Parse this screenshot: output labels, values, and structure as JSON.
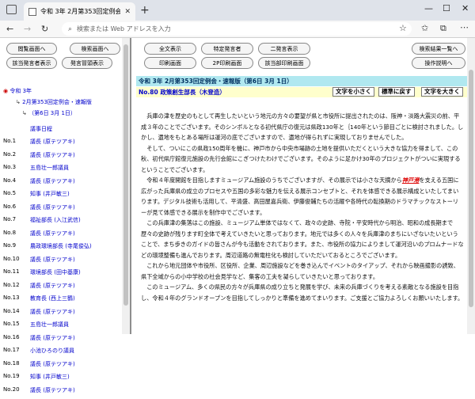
{
  "browser": {
    "tab_title": "令和 3年 2月第353回定例会・速報",
    "tab_close": "✕",
    "new_tab": "+",
    "address_placeholder": "検索または Web アドレスを入力"
  },
  "left": {
    "buttons": {
      "meeting_view": "閲覧画面へ",
      "search_view": "検索画面へ",
      "speaker_list": "該当発言者表示",
      "speaker_heading": "発言冒頭表示"
    },
    "tree": {
      "year": "令和 3年",
      "session": "2月第353回定例会・速報版",
      "day": "（第6日 3月 1日）",
      "agenda": "議事日程"
    },
    "speakers": [
      {
        "no": "No.1",
        "name": "議長 (原テツアキ)"
      },
      {
        "no": "No.2",
        "name": "議長 (原テツアキ)"
      },
      {
        "no": "No.3",
        "name": "五島壮一郎議員"
      },
      {
        "no": "No.4",
        "name": "議長 (原テツアキ)"
      },
      {
        "no": "No.5",
        "name": "知事 (井戸敏三)"
      },
      {
        "no": "No.6",
        "name": "議長 (原テツアキ)"
      },
      {
        "no": "No.7",
        "name": "福祉部長 (入江武信)"
      },
      {
        "no": "No.8",
        "name": "議長 (原テツアキ)"
      },
      {
        "no": "No.9",
        "name": "農政環境部長 (寺尾俊弘)"
      },
      {
        "no": "No.10",
        "name": "議長 (原テツアキ)"
      },
      {
        "no": "No.11",
        "name": "環境部長 (田中基康)"
      },
      {
        "no": "No.12",
        "name": "議長 (原テツアキ)"
      },
      {
        "no": "No.13",
        "name": "教育長 (西上三鶴)"
      },
      {
        "no": "No.14",
        "name": "議長 (原テツアキ)"
      },
      {
        "no": "No.15",
        "name": "五島壮一郎議員"
      },
      {
        "no": "No.16",
        "name": "議長 (原テツアキ)"
      },
      {
        "no": "No.17",
        "name": "小池ひろのり議員"
      },
      {
        "no": "No.18",
        "name": "議長 (原テツアキ)"
      },
      {
        "no": "No.19",
        "name": "知事 (井戸敏三)"
      },
      {
        "no": "No.20",
        "name": "議長 (原テツアキ)"
      }
    ]
  },
  "right": {
    "buttons": {
      "full_text": "全文表示",
      "specific_speaker": "特定発言者",
      "two_speakers": "二発言表示",
      "search_results": "検索結果一覧へ",
      "print_view": "印刷画面",
      "print_2p": "2P印刷画面",
      "print_selected": "該当部印刷画面",
      "operation_help": "操作説明へ"
    },
    "header_title": "令和 3年 2月第353回定例会・速報版（第6日 3月 1日）",
    "speech_no": "No.80",
    "speech_speaker": "政策創生部長（木登造）",
    "size_small": "文字を小さく",
    "size_reset": "標準に戻す",
    "size_large": "文字を大きく",
    "paragraphs": [
      "兵庫の津を歴史のもとして再生したいという地元の方々の要望が県と市役所に提出されたのは、阪神・淡路大震災の前、平成３年のことでございます。そのシンボルとなる初代県庁の復元は県政130年と｛140年という節目ごとに検討されました。しかし、遺地をもとある場所は運河の底でございますので、遺地が得られずに実現しておりませんでした。",
      "そして、ついにこの県政150周年を機に、神戸市から中央市場跡の土地を提供いただくという大きな協力を得まして、この秋、初代県庁館復元施設の先行会館にこぎつけたわけでございます。そのように足かけ30年のプロジェクトがついに実現するということでございます。",
      "令和４年度開館を目指しますミュージアム施設のうちでございますが、その展示では小さな天摘から",
      "を支える五国に広がった兵庫県の成立のプロセスや五国の多彩な魅力を伝える展示コンセプトと、それを体感できる展示構成といたしてまいります。デジタル技術も活用して、平清盛、高田屋嘉兵衛、伊藤俊輔たちの活躍や各時代の転換期のドラマチックなストーリーが見て体感できる展示を制作中でございます。",
      "この兵庫津の集落はこの施設、ミュージアム単体ではなくて、政々の史跡、寺院・平安時代から明治、昭和の成長期まで歴々の史跡が残ります町全体で考えていきたいと思っております。地元では多くの人々を兵庫津のまちにいざないたいということで、まち歩きのガイドの皆さんが今も活動をされております。また、市役所の協力によりまして運河沿いのプロムナードなどの環境整備も進んでおります。周辺道路の無電柱化も検討していただいておるところでございます。",
      "これから地元団体や市役所、区役所、企業、周辺施設などを巻き込んでイベントのタイアップ、それから映画撮影の誘致、県下全域からの小中学校の社会見学など、集客の工夫を凝らしていきたいと思っております。",
      "このミュージアム、多くの県民の方々が兵庫県の成り立ちと発展を学び、未来の兵庫づくりを考える素敵となる施設を目指し、令和４年のグランドオープンを目指してしっかりと準備を進めてまいります。ご支援とご協力よろしくお願いいたします。"
    ],
    "inline_link": "神戸港"
  }
}
